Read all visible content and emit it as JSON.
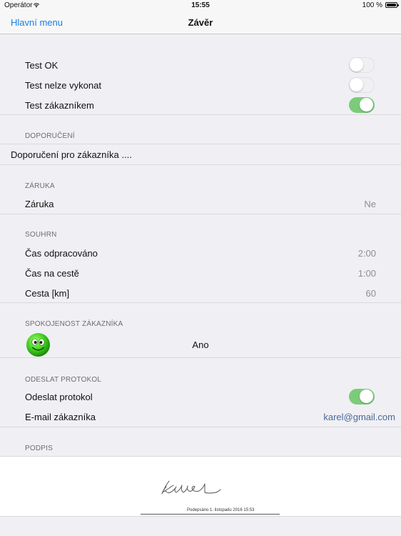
{
  "status_bar": {
    "carrier": "Operátor",
    "time": "15:55",
    "battery_percent": "100 %",
    "battery_level": 1.0
  },
  "nav": {
    "back_label": "Hlavní menu",
    "title": "Závěr"
  },
  "tests": {
    "rows": [
      {
        "label": "Test OK",
        "on": false
      },
      {
        "label": "Test nelze vykonat",
        "on": false
      },
      {
        "label": "Test zákazníkem",
        "on": true
      }
    ]
  },
  "doporuceni": {
    "header": "DOPORUČENÍ",
    "text": "Doporučení pro zákazníka ...."
  },
  "zaruka": {
    "header": "ZÁRUKA",
    "label": "Záruka",
    "value": "Ne"
  },
  "souhrn": {
    "header": "SOUHRN",
    "rows": [
      {
        "label": "Čas odpracováno",
        "value": "2:00"
      },
      {
        "label": "Čas na cestě",
        "value": "1:00"
      },
      {
        "label": "Cesta [km]",
        "value": "60"
      }
    ]
  },
  "spokojenost": {
    "header": "SPOKOJENOST ZÁKAZNÍKA",
    "icon": "smiley-face-icon",
    "value": "Ano"
  },
  "odeslat": {
    "header": "ODESLAT PROTOKOL",
    "label": "Odeslat protokol",
    "on": true,
    "email_label": "E-mail zákazníka",
    "email_value": "karel@gmail.com"
  },
  "podpis": {
    "header": "PODPIS",
    "caption": "Podepsáno 1. listopadu 2016 15:53"
  },
  "colors": {
    "accent": "#1a7ce6",
    "switch_on": "#7ccb7a",
    "email": "#4a6a94"
  }
}
